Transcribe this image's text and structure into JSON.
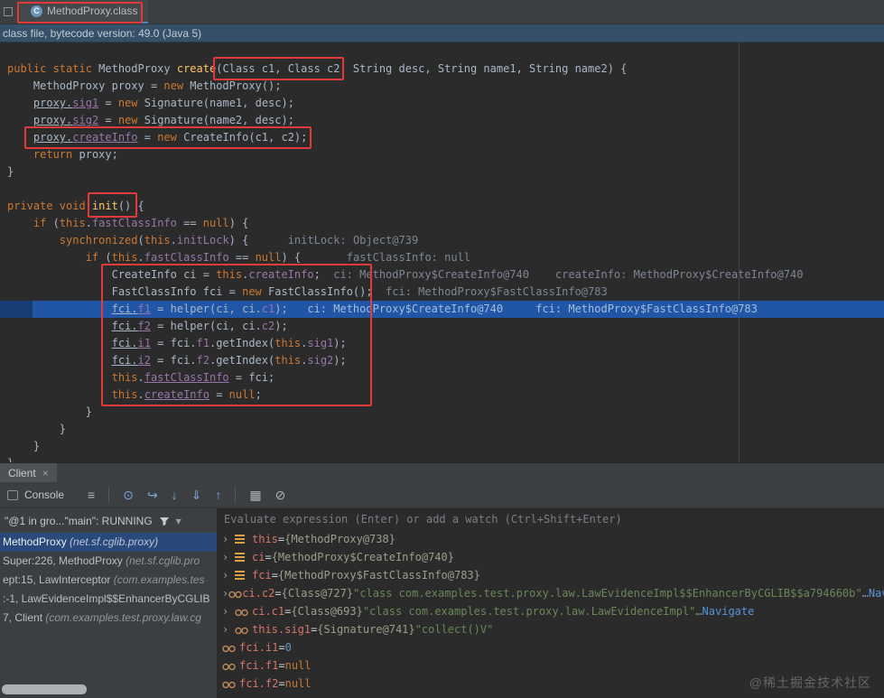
{
  "colors": {
    "annotation_red": "#e03a3a",
    "execution_line_blue": "#2155a5",
    "frame_selection_blue": "#29497a",
    "editor_background": "#2b2b2b",
    "panel_background": "#3c3f41"
  },
  "icons": {
    "close": "×",
    "caret": "▾",
    "chevron": "›"
  },
  "tabbar": {
    "title": "MethodProxy.class"
  },
  "banner": {
    "text": "class file, bytecode version: 49.0 (Java 5)"
  },
  "editor": {
    "exec_line_index": 14,
    "lines": [
      [
        [
          "k",
          "public static "
        ],
        [
          "p",
          "MethodProxy "
        ],
        [
          "m",
          "create"
        ],
        [
          "p",
          "(Class c1, Class c2, String desc, String name1, String name2) {"
        ]
      ],
      [
        [
          "p",
          "    MethodProxy proxy = "
        ],
        [
          "k",
          "new"
        ],
        [
          "p",
          " MethodProxy();"
        ]
      ],
      [
        [
          "p",
          "    "
        ],
        [
          "pu",
          "proxy."
        ],
        [
          "fu",
          "sig1"
        ],
        [
          "p",
          " = "
        ],
        [
          "k",
          "new"
        ],
        [
          "p",
          " Signature(name1, desc);"
        ]
      ],
      [
        [
          "p",
          "    "
        ],
        [
          "pu",
          "proxy."
        ],
        [
          "fu",
          "sig2"
        ],
        [
          "p",
          " = "
        ],
        [
          "k",
          "new"
        ],
        [
          "p",
          " Signature(name2, desc);"
        ]
      ],
      [
        [
          "p",
          "    "
        ],
        [
          "pu",
          "proxy."
        ],
        [
          "fu",
          "createInfo"
        ],
        [
          "p",
          " = "
        ],
        [
          "k",
          "new"
        ],
        [
          "p",
          " CreateInfo(c1, c2);"
        ]
      ],
      [
        [
          "p",
          "    "
        ],
        [
          "k",
          "return"
        ],
        [
          "p",
          " proxy;"
        ]
      ],
      [
        [
          "p",
          "}"
        ]
      ],
      [
        [
          "p",
          ""
        ]
      ],
      [
        [
          "k",
          "private void "
        ],
        [
          "m",
          "init"
        ],
        [
          "p",
          "() {"
        ]
      ],
      [
        [
          "p",
          "    "
        ],
        [
          "k",
          "if"
        ],
        [
          "p",
          " ("
        ],
        [
          "k",
          "this"
        ],
        [
          "p",
          "."
        ],
        [
          "f",
          "fastClassInfo"
        ],
        [
          "p",
          " == "
        ],
        [
          "k",
          "null"
        ],
        [
          "p",
          ") {"
        ]
      ],
      [
        [
          "p",
          "        "
        ],
        [
          "k",
          "synchronized"
        ],
        [
          "p",
          "("
        ],
        [
          "k",
          "this"
        ],
        [
          "p",
          "."
        ],
        [
          "f",
          "initLock"
        ],
        [
          "p",
          ") {"
        ],
        [
          "h",
          "      initLock: Object@739"
        ]
      ],
      [
        [
          "p",
          "            "
        ],
        [
          "k",
          "if"
        ],
        [
          "p",
          " ("
        ],
        [
          "k",
          "this"
        ],
        [
          "p",
          "."
        ],
        [
          "f",
          "fastClassInfo"
        ],
        [
          "p",
          " == "
        ],
        [
          "k",
          "null"
        ],
        [
          "p",
          ") {"
        ],
        [
          "h",
          "       fastClassInfo: null"
        ]
      ],
      [
        [
          "p",
          "                CreateInfo ci = "
        ],
        [
          "k",
          "this"
        ],
        [
          "p",
          "."
        ],
        [
          "f",
          "createInfo"
        ],
        [
          "p",
          ";"
        ],
        [
          "h",
          "  ci: MethodProxy$CreateInfo@740    createInfo: MethodProxy$CreateInfo@740"
        ]
      ],
      [
        [
          "p",
          "                FastClassInfo fci = "
        ],
        [
          "k",
          "new"
        ],
        [
          "p",
          " FastClassInfo();"
        ],
        [
          "h",
          "  fci: MethodProxy$FastClassInfo@783"
        ]
      ],
      [
        [
          "p",
          "                "
        ],
        [
          "pu",
          "fci."
        ],
        [
          "fu",
          "f1"
        ],
        [
          "p",
          " = helper(ci, ci."
        ],
        [
          "f",
          "c1"
        ],
        [
          "p",
          ");"
        ],
        [
          "h",
          "   ci: MethodProxy$CreateInfo@740     fci: MethodProxy$FastClassInfo@783"
        ]
      ],
      [
        [
          "p",
          "                "
        ],
        [
          "pu",
          "fci."
        ],
        [
          "fu",
          "f2"
        ],
        [
          "p",
          " = helper(ci, ci."
        ],
        [
          "f",
          "c2"
        ],
        [
          "p",
          ");"
        ]
      ],
      [
        [
          "p",
          "                "
        ],
        [
          "pu",
          "fci."
        ],
        [
          "fu",
          "i1"
        ],
        [
          "p",
          " = fci."
        ],
        [
          "f",
          "f1"
        ],
        [
          "p",
          ".getIndex("
        ],
        [
          "k",
          "this"
        ],
        [
          "p",
          "."
        ],
        [
          "f",
          "sig1"
        ],
        [
          "p",
          ");"
        ]
      ],
      [
        [
          "p",
          "                "
        ],
        [
          "pu",
          "fci."
        ],
        [
          "fu",
          "i2"
        ],
        [
          "p",
          " = fci."
        ],
        [
          "f",
          "f2"
        ],
        [
          "p",
          ".getIndex("
        ],
        [
          "k",
          "this"
        ],
        [
          "p",
          "."
        ],
        [
          "f",
          "sig2"
        ],
        [
          "p",
          ");"
        ]
      ],
      [
        [
          "p",
          "                "
        ],
        [
          "k",
          "this"
        ],
        [
          "p",
          "."
        ],
        [
          "fu",
          "fastClassInfo"
        ],
        [
          "p",
          " = fci;"
        ]
      ],
      [
        [
          "p",
          "                "
        ],
        [
          "k",
          "this"
        ],
        [
          "p",
          "."
        ],
        [
          "fu",
          "createInfo"
        ],
        [
          "p",
          " = "
        ],
        [
          "k",
          "null"
        ],
        [
          "p",
          ";"
        ]
      ],
      [
        [
          "p",
          "            }"
        ]
      ],
      [
        [
          "p",
          "        }"
        ]
      ],
      [
        [
          "p",
          "    }"
        ]
      ],
      [
        [
          "p",
          "}"
        ]
      ]
    ]
  },
  "debugger": {
    "session_tab": {
      "label": "Client"
    },
    "toolbar": {
      "console_label": "Console",
      "icons": [
        {
          "name": "layout-menu-icon",
          "glyph": "≡",
          "color": "#afb6bc"
        },
        {
          "sep": true
        },
        {
          "name": "show-execution-point-icon",
          "glyph": "⊙",
          "color": "#7da7d9"
        },
        {
          "name": "step-over-icon",
          "glyph": "↪",
          "color": "#7da7d9"
        },
        {
          "name": "step-into-icon",
          "glyph": "↓",
          "color": "#7da7d9"
        },
        {
          "name": "force-step-into-icon",
          "glyph": "⇓",
          "color": "#7da7d9"
        },
        {
          "name": "step-out-icon",
          "glyph": "↑",
          "color": "#7da7d9"
        },
        {
          "sep": true
        },
        {
          "name": "view-breakpoints-icon",
          "glyph": "▦",
          "color": "#afb6bc"
        },
        {
          "name": "mute-breakpoints-icon",
          "glyph": "⊘",
          "color": "#afb6bc"
        }
      ]
    },
    "thread": {
      "label": "\"@1 in gro...\"main\": RUNNING"
    },
    "frames": [
      {
        "main": "MethodProxy ",
        "pkg": "(net.sf.cglib.proxy)",
        "selected": true
      },
      {
        "main": "Super:226, MethodProxy ",
        "pkg": "(net.sf.cglib.pro",
        "selected": false
      },
      {
        "main": "ept:15, LawInterceptor ",
        "pkg": "(com.examples.tes",
        "selected": false
      },
      {
        "main": ":-1, LawEvidenceImpl$$EnhancerByCGLIB",
        "pkg": "",
        "selected": false
      },
      {
        "main": "7, Client ",
        "pkg": "(com.examples.test.proxy.law.cg",
        "selected": false
      }
    ],
    "evaluate_hint": "Evaluate expression (Enter) or add a watch (Ctrl+Shift+Enter)",
    "variables": [
      {
        "icon": "variable",
        "expandable": true,
        "name": "this",
        "value_parts": [
          [
            "obj",
            "{MethodProxy@738}"
          ]
        ]
      },
      {
        "icon": "variable",
        "expandable": true,
        "name": "ci",
        "value_parts": [
          [
            "obj",
            "{MethodProxy$CreateInfo@740}"
          ]
        ]
      },
      {
        "icon": "variable",
        "expandable": true,
        "name": "fci",
        "value_parts": [
          [
            "obj",
            "{MethodProxy$FastClassInfo@783}"
          ]
        ]
      },
      {
        "icon": "watch",
        "expandable": true,
        "name": "ci.c2",
        "value_parts": [
          [
            "obj",
            "{Class@727} "
          ],
          [
            "str",
            "\"class com.examples.test.proxy.law.LawEvidenceImpl$$EnhancerByCGLIB$$a794660b\""
          ],
          [
            "dim",
            " … "
          ],
          [
            "link",
            "Navigate"
          ]
        ]
      },
      {
        "icon": "watch",
        "expandable": true,
        "name": "ci.c1",
        "value_parts": [
          [
            "obj",
            "{Class@693} "
          ],
          [
            "str",
            "\"class com.examples.test.proxy.law.LawEvidenceImpl\""
          ],
          [
            "dim",
            " … "
          ],
          [
            "link",
            "Navigate"
          ]
        ]
      },
      {
        "icon": "watch",
        "expandable": true,
        "name": "this.sig1",
        "value_parts": [
          [
            "obj",
            "{Signature@741} "
          ],
          [
            "str",
            "\"collect()V\""
          ]
        ]
      },
      {
        "icon": "watch",
        "expandable": false,
        "name": "fci.i1",
        "value_parts": [
          [
            "num",
            "0"
          ]
        ]
      },
      {
        "icon": "watch",
        "expandable": false,
        "name": "fci.f1",
        "value_parts": [
          [
            "kw",
            "null"
          ]
        ]
      },
      {
        "icon": "watch",
        "expandable": false,
        "name": "fci.f2",
        "value_parts": [
          [
            "kw",
            "null"
          ]
        ]
      }
    ]
  },
  "watermark": {
    "text": "@稀土掘金技术社区"
  }
}
